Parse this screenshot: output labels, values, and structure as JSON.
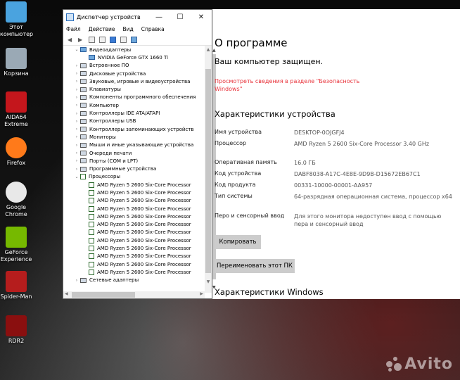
{
  "desktop": {
    "icons": [
      {
        "label": "Этот\nкомпьютер",
        "icon": "computer-icon"
      },
      {
        "label": "Корзина",
        "icon": "recycle-bin-icon"
      },
      {
        "label": "AIDA64\nExtreme",
        "icon": "aida64-icon"
      },
      {
        "label": "Firefox",
        "icon": "firefox-icon"
      },
      {
        "label": "Google\nChrome",
        "icon": "chrome-icon"
      },
      {
        "label": "GeForce\nExperience",
        "icon": "geforce-icon"
      },
      {
        "label": "Spider-Man",
        "icon": "spiderman-icon"
      },
      {
        "label": "RDR2",
        "icon": "rdr2-icon"
      }
    ],
    "watermark": "Avito"
  },
  "device_manager": {
    "title": "Диспетчер устройств",
    "window_controls": [
      "—",
      "☐",
      "✕"
    ],
    "menu": [
      "Файл",
      "Действие",
      "Вид",
      "Справка"
    ],
    "tree": [
      {
        "label": "Видеоадаптеры",
        "level": 0,
        "expanded": true,
        "icon": "display-adapter-icon"
      },
      {
        "label": "NVIDIA GeForce GTX 1660 Ti",
        "level": 1,
        "icon": "gpu-icon"
      },
      {
        "label": "Встроенное ПО",
        "level": 0,
        "icon": "firmware-icon"
      },
      {
        "label": "Дисковые устройства",
        "level": 0,
        "icon": "disk-icon"
      },
      {
        "label": "Звуковые, игровые и видеоустройства",
        "level": 0,
        "icon": "sound-icon"
      },
      {
        "label": "Клавиатуры",
        "level": 0,
        "icon": "keyboard-icon"
      },
      {
        "label": "Компоненты программного обеспечения",
        "level": 0,
        "icon": "software-component-icon"
      },
      {
        "label": "Компьютер",
        "level": 0,
        "icon": "computer-icon"
      },
      {
        "label": "Контроллеры IDE ATA/ATAPI",
        "level": 0,
        "icon": "ide-controller-icon"
      },
      {
        "label": "Контроллеры USB",
        "level": 0,
        "icon": "usb-icon"
      },
      {
        "label": "Контроллеры запоминающих устройств",
        "level": 0,
        "icon": "storage-controller-icon"
      },
      {
        "label": "Мониторы",
        "level": 0,
        "icon": "monitor-icon"
      },
      {
        "label": "Мыши и иные указывающие устройства",
        "level": 0,
        "icon": "mouse-icon"
      },
      {
        "label": "Очереди печати",
        "level": 0,
        "icon": "print-queue-icon"
      },
      {
        "label": "Порты (COM и LPT)",
        "level": 0,
        "icon": "port-icon"
      },
      {
        "label": "Программные устройства",
        "level": 0,
        "icon": "software-device-icon"
      },
      {
        "label": "Процессоры",
        "level": 0,
        "expanded": true,
        "icon": "processor-icon"
      },
      {
        "label": "AMD Ryzen 5 2600 Six-Core Processor",
        "level": 1,
        "icon": "cpu-icon"
      },
      {
        "label": "AMD Ryzen 5 2600 Six-Core Processor",
        "level": 1,
        "icon": "cpu-icon"
      },
      {
        "label": "AMD Ryzen 5 2600 Six-Core Processor",
        "level": 1,
        "icon": "cpu-icon"
      },
      {
        "label": "AMD Ryzen 5 2600 Six-Core Processor",
        "level": 1,
        "icon": "cpu-icon"
      },
      {
        "label": "AMD Ryzen 5 2600 Six-Core Processor",
        "level": 1,
        "icon": "cpu-icon"
      },
      {
        "label": "AMD Ryzen 5 2600 Six-Core Processor",
        "level": 1,
        "icon": "cpu-icon"
      },
      {
        "label": "AMD Ryzen 5 2600 Six-Core Processor",
        "level": 1,
        "icon": "cpu-icon"
      },
      {
        "label": "AMD Ryzen 5 2600 Six-Core Processor",
        "level": 1,
        "icon": "cpu-icon"
      },
      {
        "label": "AMD Ryzen 5 2600 Six-Core Processor",
        "level": 1,
        "icon": "cpu-icon"
      },
      {
        "label": "AMD Ryzen 5 2600 Six-Core Processor",
        "level": 1,
        "icon": "cpu-icon"
      },
      {
        "label": "AMD Ryzen 5 2600 Six-Core Processor",
        "level": 1,
        "icon": "cpu-icon"
      },
      {
        "label": "AMD Ryzen 5 2600 Six-Core Processor",
        "level": 1,
        "icon": "cpu-icon"
      },
      {
        "label": "Сетевые адаптеры",
        "level": 0,
        "icon": "network-adapter-icon"
      }
    ]
  },
  "about": {
    "title": "О программе",
    "protected": "Ваш компьютер защищен.",
    "security_link": "Просмотреть сведения в разделе \"Безопасность Windows\"",
    "device_specs_heading": "Характеристики устройства",
    "specs": [
      {
        "label": "Имя устройства",
        "value": "DESKTOP-0OJGFJ4"
      },
      {
        "label": "Процессор",
        "value": "AMD Ryzen 5 2600 Six-Core Processor 3.40 GHz"
      },
      {
        "label": "Оперативная память",
        "value": "16.0 ГБ"
      },
      {
        "label": "Код устройства",
        "value": "DABF8038-A17C-4E8E-9D9B-D15672EB67C1"
      },
      {
        "label": "Код продукта",
        "value": "00331-10000-00001-AA957"
      },
      {
        "label": "Тип системы",
        "value": "64-разрядная операционная система, процессор x64"
      },
      {
        "label": "Перо и сенсорный ввод",
        "value": "Для этого монитора недоступен ввод с помощью пера и сенсорный ввод"
      }
    ],
    "copy_button": "Копировать",
    "rename_button": "Переименовать этот ПК",
    "windows_specs_heading": "Характеристики Windows"
  }
}
